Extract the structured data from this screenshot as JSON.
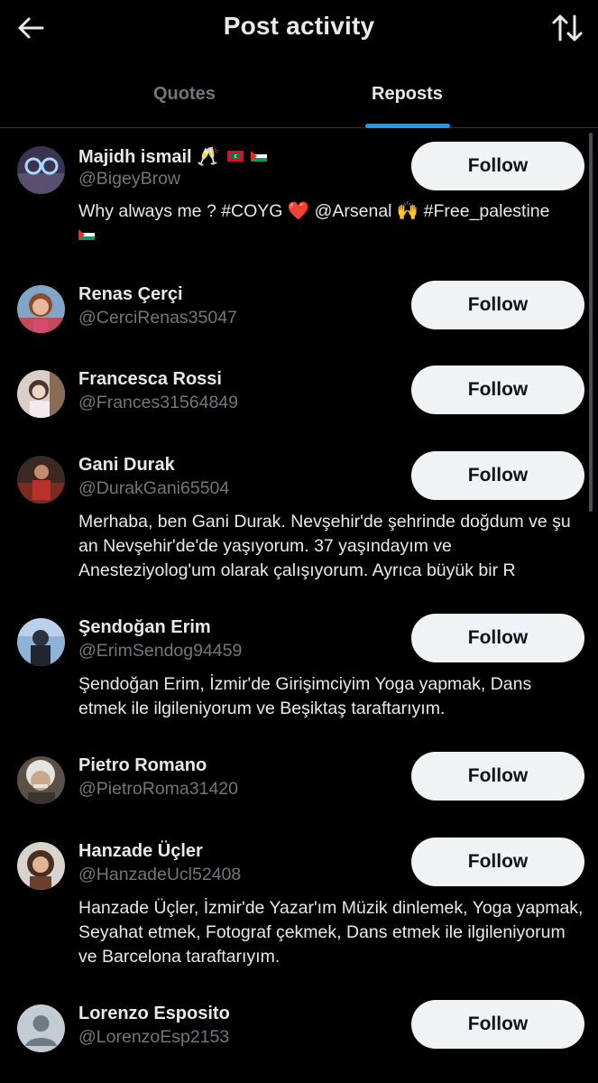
{
  "header": {
    "title": "Post activity",
    "back_icon": "arrow-left-icon",
    "sort_icon": "sort-arrows-icon"
  },
  "tabs": [
    {
      "label": "Quotes",
      "active": false
    },
    {
      "label": "Reposts",
      "active": true
    }
  ],
  "accent_color": "#1d9bf0",
  "users": [
    {
      "name": "Majidh ismail",
      "name_suffix": "🥂",
      "handle": "@BigeyBrow",
      "bio_parts": [
        "Why always me ? #COYG ",
        "❤️",
        " @Arsenal 🙌 #Free_palestine"
      ],
      "follow_label": "Follow"
    },
    {
      "name": "Renas Çerçi",
      "handle": "@CerciRenas35047",
      "follow_label": "Follow"
    },
    {
      "name": "Francesca Rossi",
      "handle": "@Frances31564849",
      "follow_label": "Follow"
    },
    {
      "name": "Gani Durak",
      "handle": "@DurakGani65504",
      "bio": "Merhaba, ben Gani Durak. Nevşehir'de şehrinde doğdum ve şu an Nevşehir'de'de yaşıyorum. 37 yaşındayım ve Anesteziyolog'um olarak çalışıyorum. Ayrıca büyük bir R",
      "follow_label": "Follow"
    },
    {
      "name": "Şendoğan Erim",
      "handle": "@ErimSendog94459",
      "bio": "Şendoğan Erim, İzmir'de Girişimciyim Yoga yapmak, Dans etmek ile ilgileniyorum ve Beşiktaş taraftarıyım.",
      "follow_label": "Follow"
    },
    {
      "name": "Pietro Romano",
      "handle": "@PietroRoma31420",
      "follow_label": "Follow"
    },
    {
      "name": "Hanzade Üçler",
      "handle": "@HanzadeUcl52408",
      "bio": "Hanzade Üçler, İzmir'de Yazar'ım Müzik dinlemek, Yoga yapmak, Seyahat etmek, Fotograf çekmek, Dans etmek ile ilgileniyorum ve Barcelona taraftarıyım.",
      "follow_label": "Follow"
    },
    {
      "name": "Lorenzo Esposito",
      "handle": "@LorenzoEsp2153",
      "follow_label": "Follow"
    }
  ]
}
